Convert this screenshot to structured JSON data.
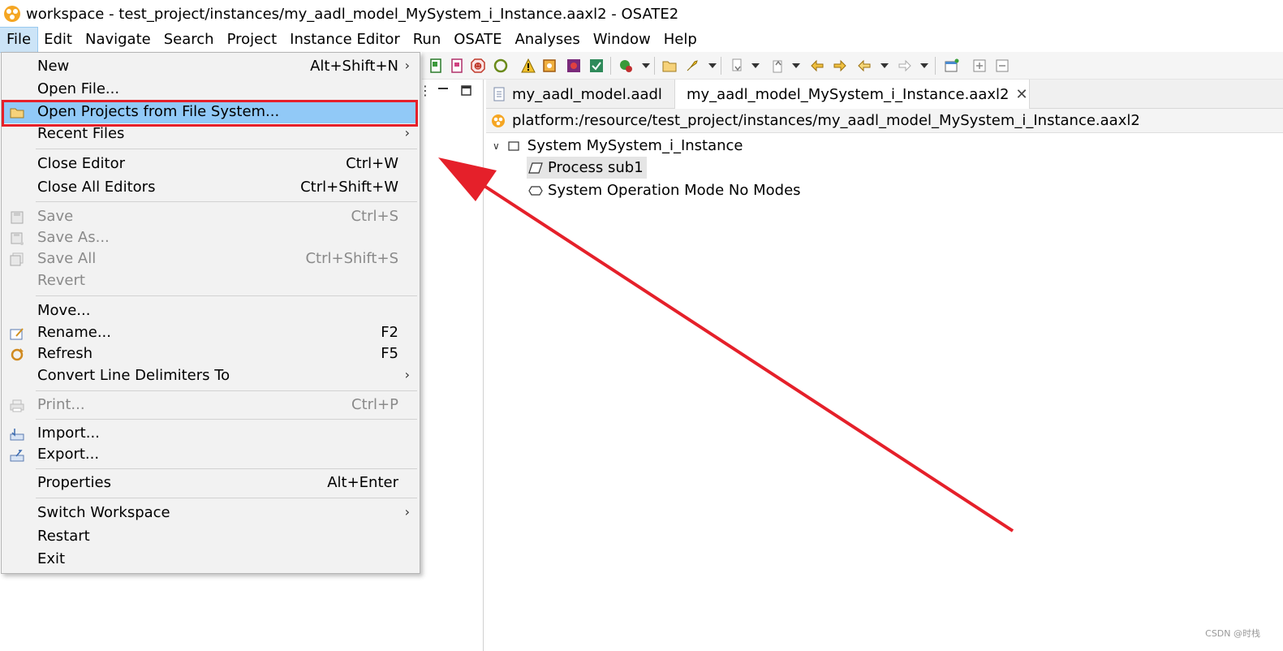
{
  "window": {
    "title": "workspace - test_project/instances/my_aadl_model_MySystem_i_Instance.aaxl2 - OSATE2"
  },
  "menubar": {
    "items": [
      {
        "label": "File"
      },
      {
        "label": "Edit"
      },
      {
        "label": "Navigate"
      },
      {
        "label": "Search"
      },
      {
        "label": "Project"
      },
      {
        "label": "Instance Editor"
      },
      {
        "label": "Run"
      },
      {
        "label": "OSATE"
      },
      {
        "label": "Analyses"
      },
      {
        "label": "Window"
      },
      {
        "label": "Help"
      }
    ]
  },
  "file_menu": {
    "items": [
      {
        "label": "New",
        "shortcut": "Alt+Shift+N"
      },
      {
        "label": "Open File..."
      },
      {
        "label": "Open Projects from File System..."
      },
      {
        "label": "Recent Files"
      },
      {
        "label": "Close Editor",
        "shortcut": "Ctrl+W"
      },
      {
        "label": "Close All Editors",
        "shortcut": "Ctrl+Shift+W"
      },
      {
        "label": "Save",
        "shortcut": "Ctrl+S"
      },
      {
        "label": "Save As..."
      },
      {
        "label": "Save All",
        "shortcut": "Ctrl+Shift+S"
      },
      {
        "label": "Revert"
      },
      {
        "label": "Move..."
      },
      {
        "label": "Rename...",
        "shortcut": "F2"
      },
      {
        "label": "Refresh",
        "shortcut": "F5"
      },
      {
        "label": "Convert Line Delimiters To"
      },
      {
        "label": "Print...",
        "shortcut": "Ctrl+P"
      },
      {
        "label": "Import..."
      },
      {
        "label": "Export..."
      },
      {
        "label": "Properties",
        "shortcut": "Alt+Enter"
      },
      {
        "label": "Switch Workspace"
      },
      {
        "label": "Restart"
      },
      {
        "label": "Exit"
      }
    ],
    "submenu_arrow": "›"
  },
  "editor": {
    "tabs": [
      {
        "label": "my_aadl_model.aadl",
        "icon": "aadl-file-icon"
      },
      {
        "label": "my_aadl_model_MySystem_i_Instance.aaxl2",
        "icon": "osate-instance-icon",
        "close": "✕"
      }
    ],
    "path": "platform:/resource/test_project/instances/my_aadl_model_MySystem_i_Instance.aaxl2",
    "tree": [
      {
        "label": "System MySystem_i_Instance",
        "expanded": true
      },
      {
        "label": "Process sub1"
      },
      {
        "label": "System Operation Mode No Modes"
      }
    ]
  },
  "watermark": "CSDN @时栈",
  "colors": {
    "menu_highlight": "#91c9f7",
    "annotation_red": "#e5202a",
    "menubar_active": "#cce4f7"
  }
}
